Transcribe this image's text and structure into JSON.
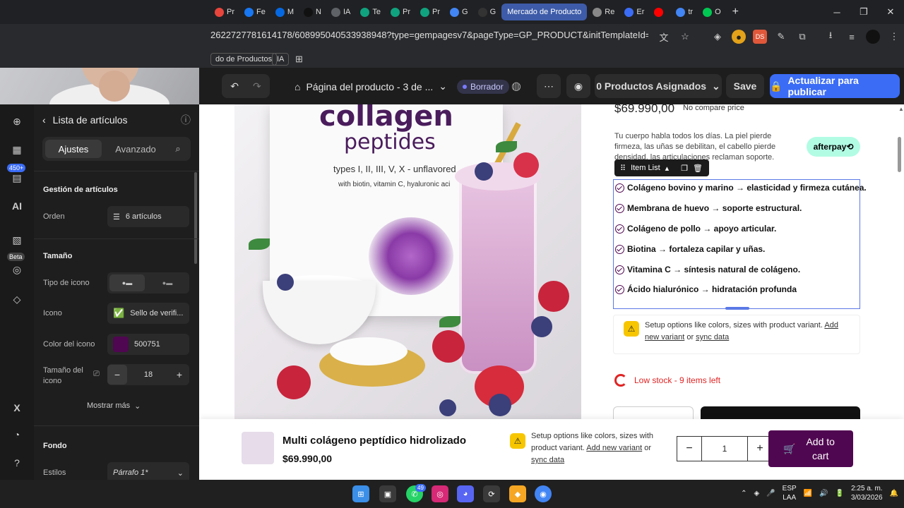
{
  "browser": {
    "tabs": [
      {
        "label": "Pr",
        "color": "#e8453c"
      },
      {
        "label": "Fe",
        "color": "#1877f2"
      },
      {
        "label": "M",
        "color": "#0668e1"
      },
      {
        "label": "N",
        "color": "#111111"
      },
      {
        "label": "IA",
        "color": "#5f6368"
      },
      {
        "label": "Te",
        "color": "#10a37f"
      },
      {
        "label": "Pr",
        "color": "#10a37f"
      },
      {
        "label": "Pr",
        "color": "#10a37f"
      },
      {
        "label": "G",
        "color": "#4285f4"
      },
      {
        "label": "G",
        "color": "#333333"
      },
      {
        "label": "Mercado de Producto",
        "color": "#3d5ba8",
        "active": true
      },
      {
        "label": "Re",
        "color": "#888888"
      },
      {
        "label": "Er",
        "color": "#3b6cf6"
      },
      {
        "label": "",
        "color": "#ff0000"
      },
      {
        "label": "tr",
        "color": "#4285f4"
      },
      {
        "label": "O",
        "color": "#00c853"
      }
    ],
    "url": "2622727781614178/608995040533938948?type=gempagesv7&pageType=GP_PRODUCT&initTemplateId=59018313100...",
    "bookmarks": [
      "do de Productos",
      "IA"
    ]
  },
  "editor": {
    "page_name": "Página del producto - 3 de ...",
    "status": "Borrador",
    "assigned": "0 Productos Asignados",
    "save": "Save",
    "publish": "Actualizar para publicar"
  },
  "rail": {
    "badge": "450+",
    "ai": "AI",
    "beta": "Beta"
  },
  "panel": {
    "title": "Lista de artículos",
    "tabs": [
      "Ajustes",
      "Avanzado"
    ],
    "management": "Gestión de artículos",
    "order_label": "Orden",
    "order_value": "6 artículos",
    "size_section": "Tamaño",
    "icon_type_label": "Tipo de icono",
    "icon_label": "Icono",
    "icon_value": "Sello de verifi...",
    "icon_color_label": "Color del icono",
    "icon_color_value": "500751",
    "icon_color_hex": "#500751",
    "icon_size_label": "Tamaño del icono",
    "icon_size_value": "18",
    "more": "Mostrar más",
    "background_section": "Fondo",
    "styles_label": "Estilos",
    "styles_value": "Párrafo 1*"
  },
  "product": {
    "bag_line1": "collagen",
    "bag_line2": "peptides",
    "bag_line3": "types I, II, III, V, X - unflavored",
    "bag_line4": "with biotin, vitamin C, hyaluronic aci",
    "price": "$69.990,00",
    "compare": "No compare price",
    "description": "Tu cuerpo habla todos los días. La piel pierde firmeza, las uñas se debilitan, el cabello pierde densidad, las articulaciones reclaman soporte.",
    "afterpay": "afterpay⟲",
    "item_list_tag": "Item List",
    "items": [
      "Colágeno bovino y marino → elasticidad y firmeza cutánea.",
      "Membrana de huevo → soporte estructural.",
      "Colágeno de pollo → apoyo articular.",
      "Biotina → fortaleza capilar y uñas.",
      "Vitamina C → síntesis natural de colágeno.",
      "Ácido hialurónico → hidratación profunda"
    ],
    "variant_warning": "Setup options like colors, sizes with product variant.",
    "add_new_variant": "Add new variant",
    "or": "or",
    "sync_data": "sync data",
    "low_stock": "Low stock - 9 items left"
  },
  "sticky": {
    "title": "Multi colágeno peptídico hidrolizado",
    "price": "$69.990,00",
    "warning": "Setup options like colors, sizes with product variant.",
    "add_new_variant": "Add new variant",
    "or": "or",
    "sync_data": "sync data",
    "qty": "1",
    "add_to_cart": "Add to cart"
  },
  "taskbar": {
    "lang": "ESP",
    "lang2": "LAA",
    "time": "2:25 a. m.",
    "date": "3/03/2026",
    "whatsapp_badge": "49"
  }
}
